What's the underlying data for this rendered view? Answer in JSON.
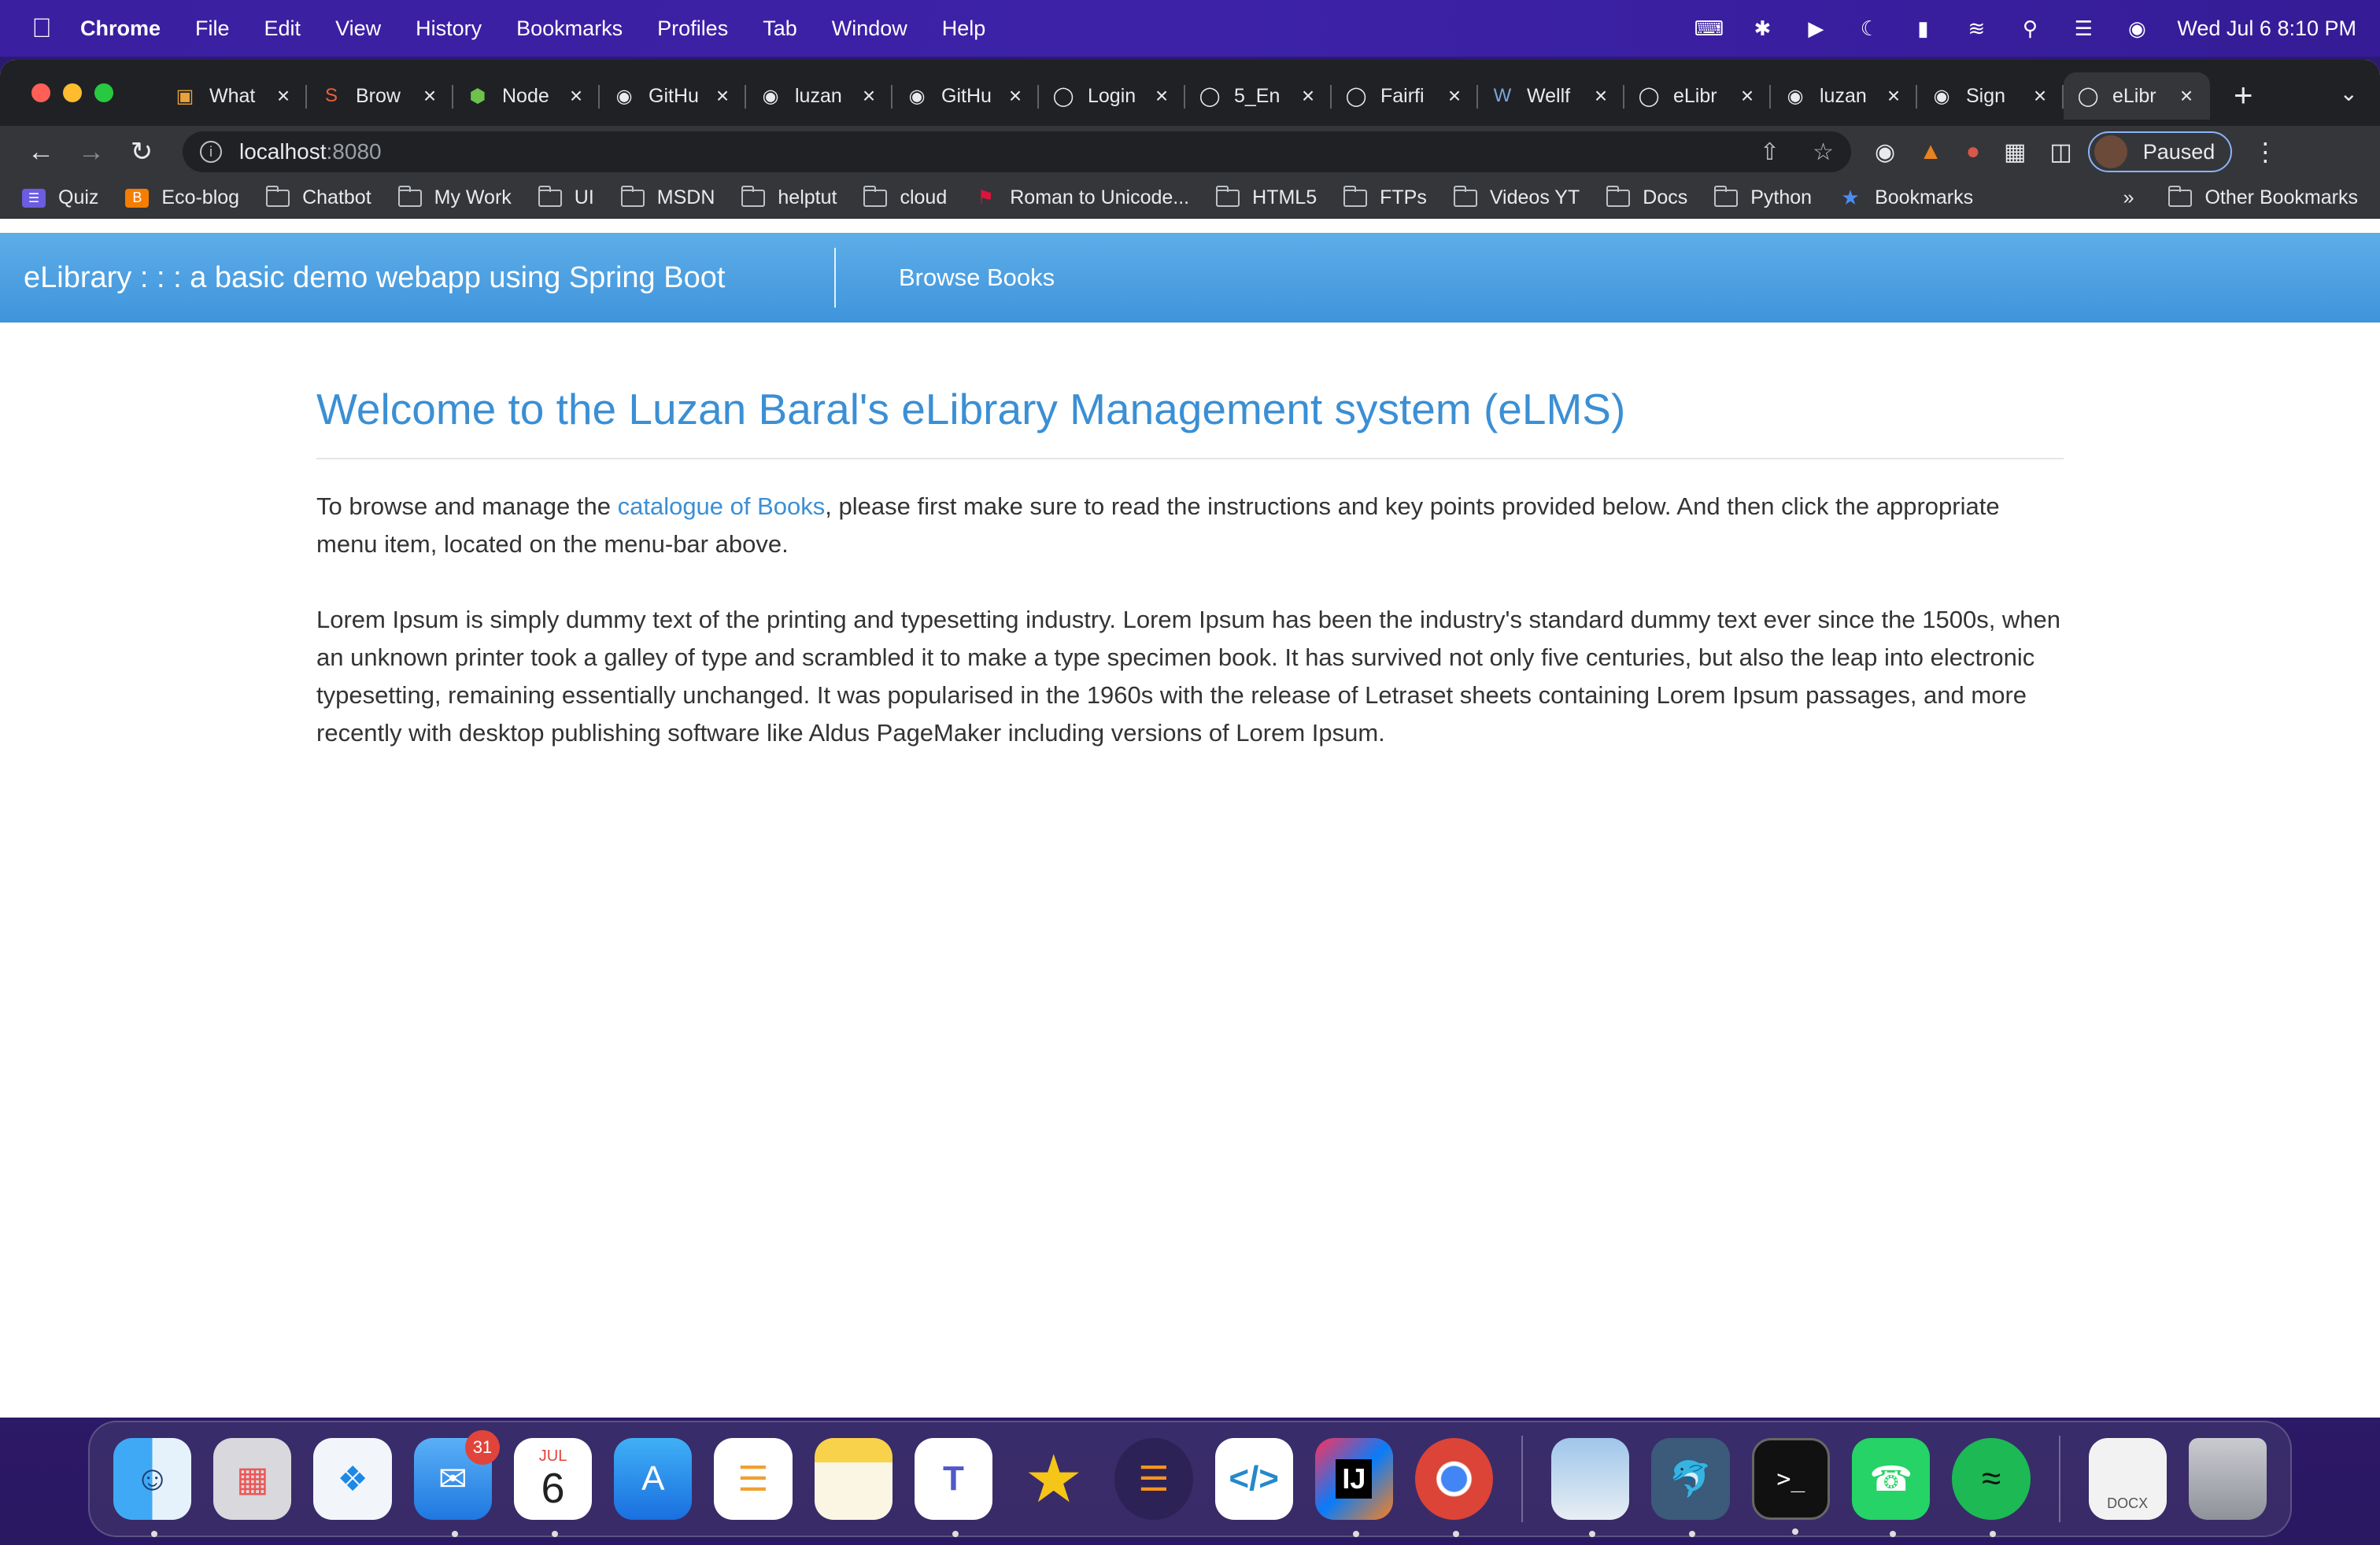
{
  "menubar": {
    "app": "Chrome",
    "items": [
      "File",
      "Edit",
      "View",
      "History",
      "Bookmarks",
      "Profiles",
      "Tab",
      "Window",
      "Help"
    ],
    "clock": "Wed Jul 6  8:10 PM"
  },
  "tabs": [
    {
      "label": "What",
      "icon": "box-icon"
    },
    {
      "label": "Brow",
      "icon": "s-icon"
    },
    {
      "label": "Node",
      "icon": "node-icon"
    },
    {
      "label": "GitHu",
      "icon": "github-icon"
    },
    {
      "label": "luzan",
      "icon": "github-icon"
    },
    {
      "label": "GitHu",
      "icon": "github-icon"
    },
    {
      "label": "Login",
      "icon": "globe-icon"
    },
    {
      "label": "5_En",
      "icon": "globe-icon"
    },
    {
      "label": "Fairfi",
      "icon": "globe-icon"
    },
    {
      "label": "Wellf",
      "icon": "w-icon"
    },
    {
      "label": "eLibr",
      "icon": "globe-icon"
    },
    {
      "label": "luzan",
      "icon": "github-icon"
    },
    {
      "label": "Sign",
      "icon": "github-icon"
    },
    {
      "label": "eLibr",
      "icon": "globe-icon",
      "active": true
    }
  ],
  "toolbar": {
    "url_host": "localhost",
    "url_port": ":8080",
    "profile_label": "Paused"
  },
  "bookmarks": {
    "items": [
      {
        "label": "Quiz",
        "icon": "list-icon"
      },
      {
        "label": "Eco-blog",
        "icon": "blogger-icon"
      },
      {
        "label": "Chatbot",
        "icon": "folder-icon"
      },
      {
        "label": "My Work",
        "icon": "folder-icon"
      },
      {
        "label": "UI",
        "icon": "folder-icon"
      },
      {
        "label": "MSDN",
        "icon": "folder-icon"
      },
      {
        "label": "helptut",
        "icon": "folder-icon"
      },
      {
        "label": "cloud",
        "icon": "folder-icon"
      },
      {
        "label": "Roman to Unicode...",
        "icon": "flag-icon"
      },
      {
        "label": "HTML5",
        "icon": "folder-icon"
      },
      {
        "label": "FTPs",
        "icon": "folder-icon"
      },
      {
        "label": "Videos YT",
        "icon": "folder-icon"
      },
      {
        "label": "Docs",
        "icon": "folder-icon"
      },
      {
        "label": "Python",
        "icon": "folder-icon"
      },
      {
        "label": "Bookmarks",
        "icon": "star-icon"
      }
    ],
    "more": "»",
    "other": "Other Bookmarks"
  },
  "page": {
    "brand": "eLibrary : : : a basic demo webapp using Spring Boot",
    "nav_link": "Browse Books",
    "heading": "Welcome to the Luzan Baral's eLibrary Management system (eLMS)",
    "intro_before": "To browse and manage the ",
    "intro_link": "catalogue of Books",
    "intro_after": ", please first make sure to read the instructions and key points provided below. And then click the appropriate menu item, located on the menu-bar above.",
    "lorem": "Lorem Ipsum is simply dummy text of the printing and typesetting industry. Lorem Ipsum has been the industry's standard dummy text ever since the 1500s, when an unknown printer took a galley of type and scrambled it to make a type specimen book. It has survived not only five centuries, but also the leap into electronic typesetting, remaining essentially unchanged. It was popularised in the 1960s with the release of Letraset sheets containing Lorem Ipsum passages, and more recently with desktop publishing software like Aldus PageMaker including versions of Lorem Ipsum."
  },
  "dock": {
    "mail_badge": "31",
    "calendar_month": "JUL",
    "calendar_day": "6",
    "apps": [
      "finder-icon",
      "launchpad-icon",
      "safari-icon",
      "mail-icon",
      "calendar-icon",
      "appstore-icon",
      "reminders-icon",
      "notes-icon",
      "teams-icon",
      "star-app-icon",
      "eclipse-icon",
      "vscode-icon",
      "intellij-icon",
      "chrome-icon",
      "preview-icon",
      "mysql-workbench-icon",
      "terminal-icon",
      "whatsapp-icon",
      "spotify-icon",
      "docx-icon",
      "trash-icon"
    ],
    "docx_label": "DOCX"
  },
  "colors": {
    "navbar": "#4a9fe0",
    "heading": "#3b8fd4",
    "chrome_dark": "#202124"
  }
}
